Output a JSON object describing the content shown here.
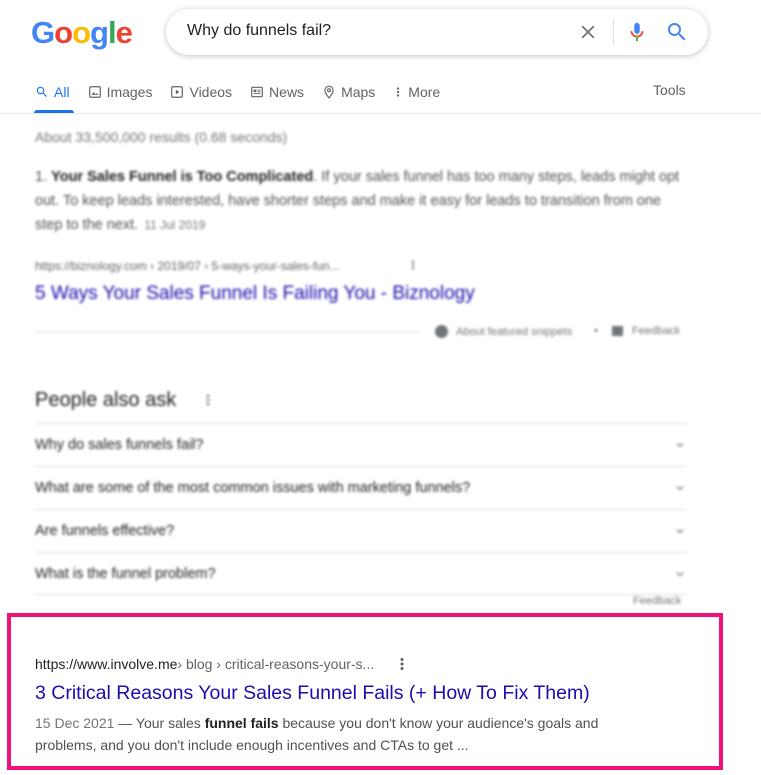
{
  "logo": {
    "text": "Google",
    "letters": [
      "G",
      "o",
      "o",
      "g",
      "l",
      "e"
    ],
    "colors": [
      "#4285f4",
      "#ea4335",
      "#fbbc05",
      "#4285f4",
      "#34a853",
      "#ea4335"
    ]
  },
  "search": {
    "query": "Why do funnels fail?"
  },
  "tabs": [
    {
      "label": "All",
      "icon": "search-icon",
      "active": true
    },
    {
      "label": "Images",
      "icon": "image-icon",
      "active": false
    },
    {
      "label": "Videos",
      "icon": "video-icon",
      "active": false
    },
    {
      "label": "News",
      "icon": "news-icon",
      "active": false
    },
    {
      "label": "Maps",
      "icon": "map-pin-icon",
      "active": false
    },
    {
      "label": "More",
      "icon": "more-vert-icon",
      "active": false
    }
  ],
  "tools_label": "Tools",
  "stats": "About 33,500,000 results (0.68 seconds)",
  "featured": {
    "number": "1.",
    "bold": "Your Sales Funnel is Too Complicated",
    "text": ". If your sales funnel has too many steps, leads might opt out. To keep leads interested, have shorter steps and make it easy for leads to transition from one step to the next.",
    "date": "11 Jul 2019",
    "url": "https://biznology.com › 2019/07 › 5-ways-your-sales-fun...",
    "title": "5 Ways Your Sales Funnel Is Failing You - Biznology",
    "about": "About featured snippets",
    "dot": "•",
    "feedback": "Feedback"
  },
  "paa": {
    "title": "People also ask",
    "questions": [
      "Why do sales funnels fail?",
      "What are some of the most common issues with marketing funnels?",
      "Are funnels effective?",
      "What is the funnel problem?"
    ],
    "feedback": "Feedback"
  },
  "result": {
    "domain": "https://www.involve.me",
    "path": " › blog › critical-reasons-your-s...",
    "title": "3 Critical Reasons Your Sales Funnel Fails (+ How To Fix Them)",
    "date": "15 Dec 2021",
    "dash": " — Your sales ",
    "bold": "funnel fails",
    "text": " because you don't know your audience's goals and problems, and you don't include enough incentives and CTAs to get ..."
  },
  "highlight_color": "#f2107a"
}
